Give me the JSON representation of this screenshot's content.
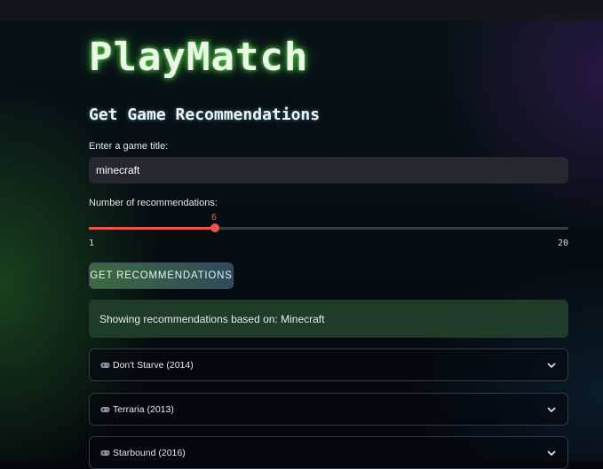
{
  "app": {
    "title": "PlayMatch"
  },
  "section": {
    "title": "Get Game Recommendations"
  },
  "title_input": {
    "label": "Enter a game title:",
    "value": "minecraft"
  },
  "slider": {
    "label": "Number of recommendations:",
    "value": "6",
    "min": "1",
    "max": "20",
    "fraction": 0.263
  },
  "button": {
    "label": "GET RECOMMENDATIONS"
  },
  "info": {
    "text": "Showing recommendations based on: Minecraft"
  },
  "results": [
    {
      "label": "Don't Starve (2014)",
      "icon": "game-controller-icon"
    },
    {
      "label": "Terraria (2013)",
      "icon": "game-controller-icon"
    },
    {
      "label": "Starbound (2016)",
      "icon": "game-controller-icon"
    }
  ],
  "colors": {
    "accent": "#ef5350",
    "info_bg": "#1f3b2a",
    "input_bg": "#26272f"
  }
}
